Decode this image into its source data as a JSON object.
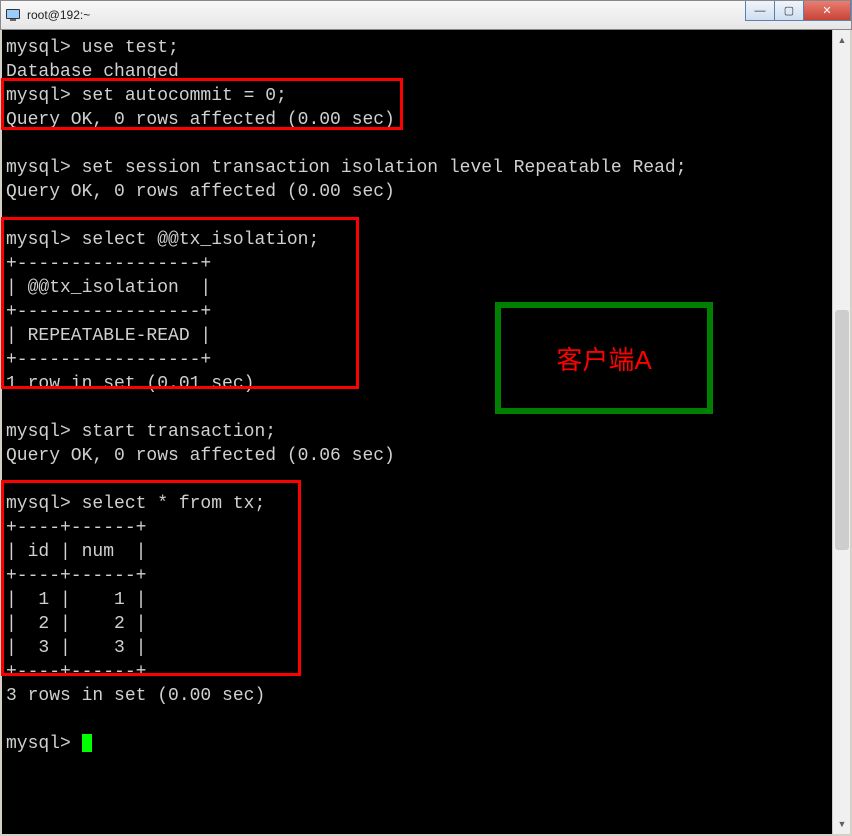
{
  "window": {
    "title": "root@192:~"
  },
  "terminal": {
    "lines": [
      "mysql> use test;",
      "Database changed",
      "mysql> set autocommit = 0;",
      "Query OK, 0 rows affected (0.00 sec)",
      "",
      "mysql> set session transaction isolation level Repeatable Read;",
      "Query OK, 0 rows affected (0.00 sec)",
      "",
      "mysql> select @@tx_isolation;",
      "+-----------------+",
      "| @@tx_isolation  |",
      "+-----------------+",
      "| REPEATABLE-READ |",
      "+-----------------+",
      "1 row in set (0.01 sec)",
      "",
      "mysql> start transaction;",
      "Query OK, 0 rows affected (0.06 sec)",
      "",
      "mysql> select * from tx;",
      "+----+------+",
      "| id | num  |",
      "+----+------+",
      "|  1 |    1 |",
      "|  2 |    2 |",
      "|  3 |    3 |",
      "+----+------+",
      "3 rows in set (0.00 sec)",
      "",
      "mysql> "
    ],
    "prompt": "mysql> "
  },
  "annotations": {
    "client_label": "客户端A"
  },
  "win_buttons": {
    "minimize": "—",
    "maximize": "▢",
    "close": "✕"
  },
  "scroll": {
    "up": "▲",
    "down": "▼"
  }
}
